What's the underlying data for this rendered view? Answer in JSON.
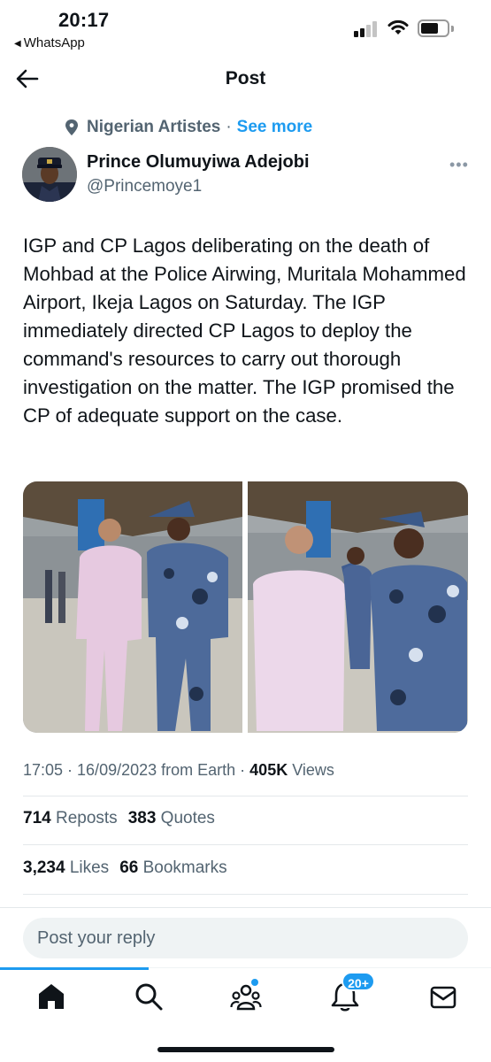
{
  "status_bar": {
    "time": "20:17",
    "back_app": "WhatsApp",
    "signal_icon": "signal-icon",
    "wifi_icon": "wifi-icon",
    "battery_icon": "battery-icon",
    "battery_level": 0.55
  },
  "header": {
    "title": "Post",
    "back_icon": "arrow-left-icon"
  },
  "post": {
    "community_icon": "community-pin-icon",
    "community": "Nigerian Artistes",
    "separator": "·",
    "see_more": "See more",
    "author_name": "Prince Olumuyiwa Adejobi",
    "author_handle": "@Princemoye1",
    "more_icon": "more-dots-icon",
    "more_glyph": "•••",
    "text": "IGP and CP Lagos deliberating on the death of Mohbad at the Police Airwing, Muritala Mohammed Airport, Ikeja Lagos on Saturday. The IGP immediately directed CP Lagos to deploy the command's resources to carry out thorough investigation on the matter. The IGP promised the CP of adequate support on the case.",
    "meta_time": "17:05 · 16/09/2023 from Earth ·",
    "views_count": "405K",
    "views_label": "Views",
    "reposts_count": "714",
    "reposts_label": "Reposts",
    "quotes_count": "383",
    "quotes_label": "Quotes",
    "likes_count": "3,234",
    "likes_label": "Likes",
    "bookmarks_count": "66",
    "bookmarks_label": "Bookmarks"
  },
  "reply": {
    "placeholder": "Post your reply"
  },
  "tab_bar": {
    "tabs": [
      {
        "name": "home",
        "icon": "home-icon",
        "active": true
      },
      {
        "name": "search",
        "icon": "search-icon"
      },
      {
        "name": "communities",
        "icon": "communities-icon"
      },
      {
        "name": "notifications",
        "icon": "bell-icon"
      },
      {
        "name": "messages",
        "icon": "envelope-icon"
      }
    ],
    "notification_badge": "20+"
  },
  "colors": {
    "accent": "#1d9bf0",
    "text": "#0f1419",
    "secondary": "#536471"
  }
}
